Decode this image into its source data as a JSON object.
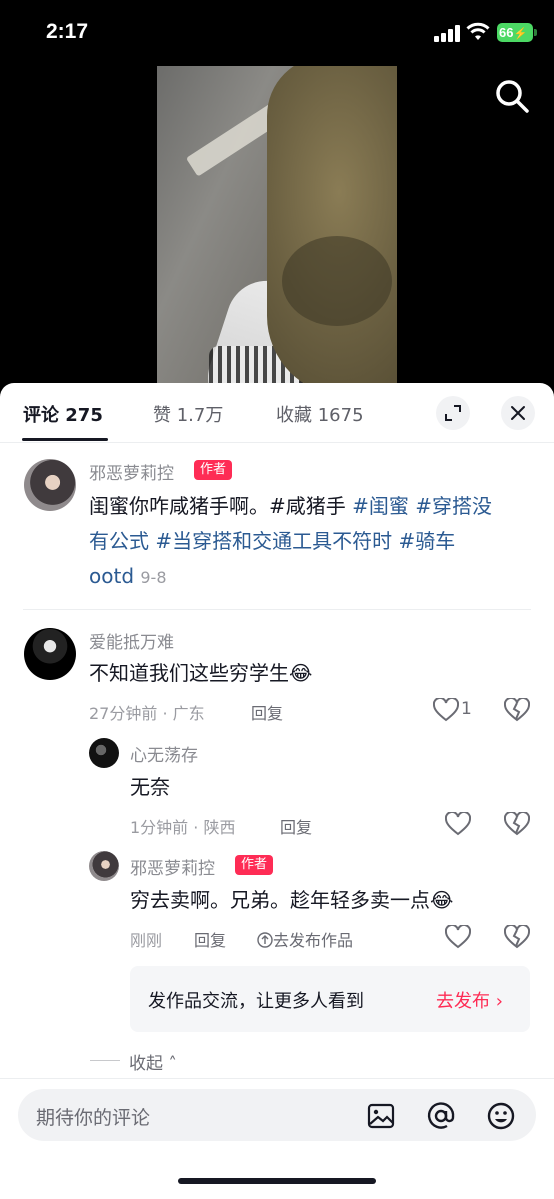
{
  "status_bar": {
    "time": "2:17",
    "battery": "66"
  },
  "tabs": [
    {
      "label": "评论 275"
    },
    {
      "label": "赞 1.7万"
    },
    {
      "label": "收藏 1675"
    }
  ],
  "comments": {
    "main": {
      "user": "邪恶萝莉控",
      "badge": "作者",
      "line1_text": "闺蜜你咋咸猪手啊。#咸猪手 ",
      "line1_tags": "#闺蜜 #穿搭没",
      "line2": "有公式 #当穿搭和交通工具不符时 #骑车",
      "line3_tag": "ootd",
      "date": "9-8"
    },
    "c2": {
      "user": "爱能抵万难",
      "text": "不知道我们这些穷学生😂",
      "meta": "27分钟前 · 广东",
      "reply": "回复",
      "likes": "1"
    },
    "c3": {
      "user": "心无荡存",
      "text": "无奈",
      "meta": "1分钟前 · 陕西",
      "reply": "回复"
    },
    "c4": {
      "user": "邪恶萝莉控",
      "badge": "作者",
      "text": "穷去卖啊。兄弟。趁年轻多卖一点😂",
      "meta": "刚刚",
      "reply": "回复",
      "publish": "去发布作品"
    }
  },
  "promo": {
    "text": "发作品交流，让更多人看到",
    "link": "去发布 ›"
  },
  "collapse": "收起 ˄",
  "input": {
    "placeholder": "期待你的评论"
  },
  "icons": [
    "search-icon",
    "expand-icon",
    "close-icon",
    "heart-icon",
    "dislike-icon",
    "image-icon",
    "at-icon",
    "emoji-icon",
    "upload-icon"
  ]
}
